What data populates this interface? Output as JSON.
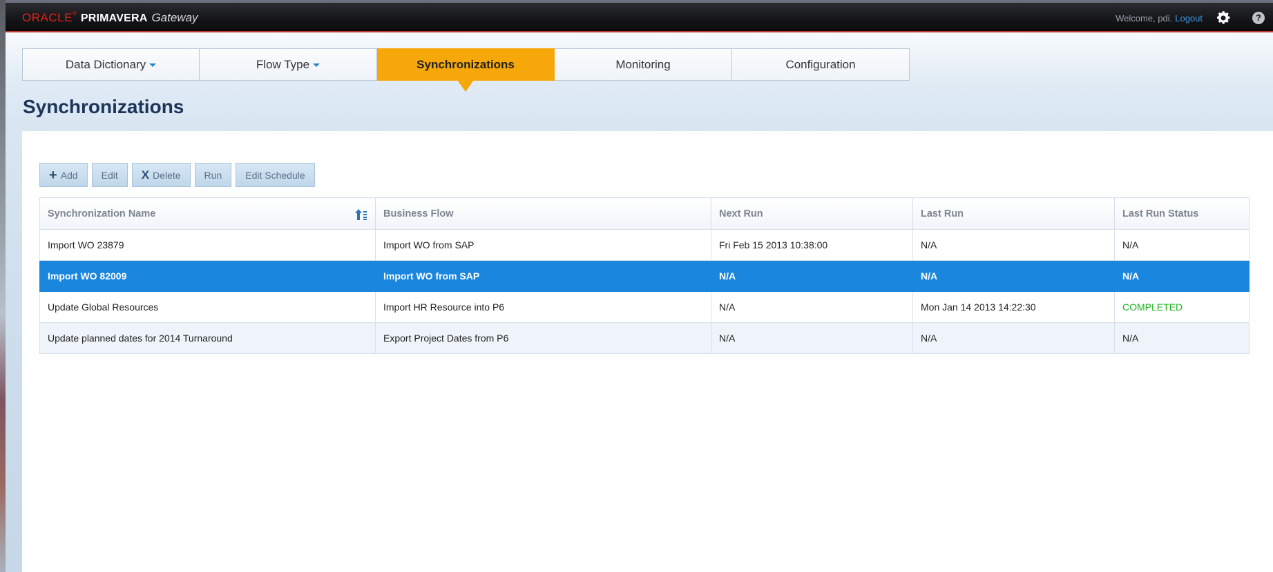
{
  "brand": {
    "oracle": "ORACLE",
    "registered": "®",
    "product": "PRIMAVERA",
    "module": "Gateway"
  },
  "user": {
    "welcome": "Welcome, pdi.",
    "logout": "Logout",
    "settings_icon": "gear-icon",
    "help_icon": "help-icon",
    "help_glyph": "?"
  },
  "nav": {
    "tabs": [
      {
        "label": "Data Dictionary",
        "dropdown": true,
        "active": false
      },
      {
        "label": "Flow Type",
        "dropdown": true,
        "active": false
      },
      {
        "label": "Synchronizations",
        "dropdown": false,
        "active": true
      },
      {
        "label": "Monitoring",
        "dropdown": false,
        "active": false
      },
      {
        "label": "Configuration",
        "dropdown": false,
        "active": false
      }
    ]
  },
  "page": {
    "title": "Synchronizations"
  },
  "toolbar": {
    "add": "Add",
    "edit": "Edit",
    "delete": "Delete",
    "run": "Run",
    "edit_schedule": "Edit Schedule"
  },
  "table": {
    "columns": [
      "Synchronization Name",
      "Business Flow",
      "Next Run",
      "Last Run",
      "Last Run Status"
    ],
    "sort_icon": "sort-ascending-icon",
    "rows": [
      {
        "name": "Import WO 23879",
        "flow": "Import WO from SAP",
        "next_run": "Fri Feb 15 2013 10:38:00",
        "last_run": "N/A",
        "status": "N/A",
        "selected": false
      },
      {
        "name": "Import WO 82009",
        "flow": "Import WO from SAP",
        "next_run": "N/A",
        "last_run": "N/A",
        "status": "N/A",
        "selected": true
      },
      {
        "name": "Update Global Resources",
        "flow": "Import HR Resource into P6",
        "next_run": "N/A",
        "last_run": "Mon Jan 14 2013 14:22:30",
        "status": "COMPLETED",
        "selected": false
      },
      {
        "name": "Update planned dates for 2014 Turnaround",
        "flow": "Export Project Dates from P6",
        "next_run": "N/A",
        "last_run": "N/A",
        "status": "N/A",
        "selected": false
      }
    ]
  },
  "colors": {
    "accent_tab": "#f6a70a",
    "selected_row": "#1a86de",
    "status_completed": "#1bb21b",
    "title_text": "#1c3558"
  }
}
